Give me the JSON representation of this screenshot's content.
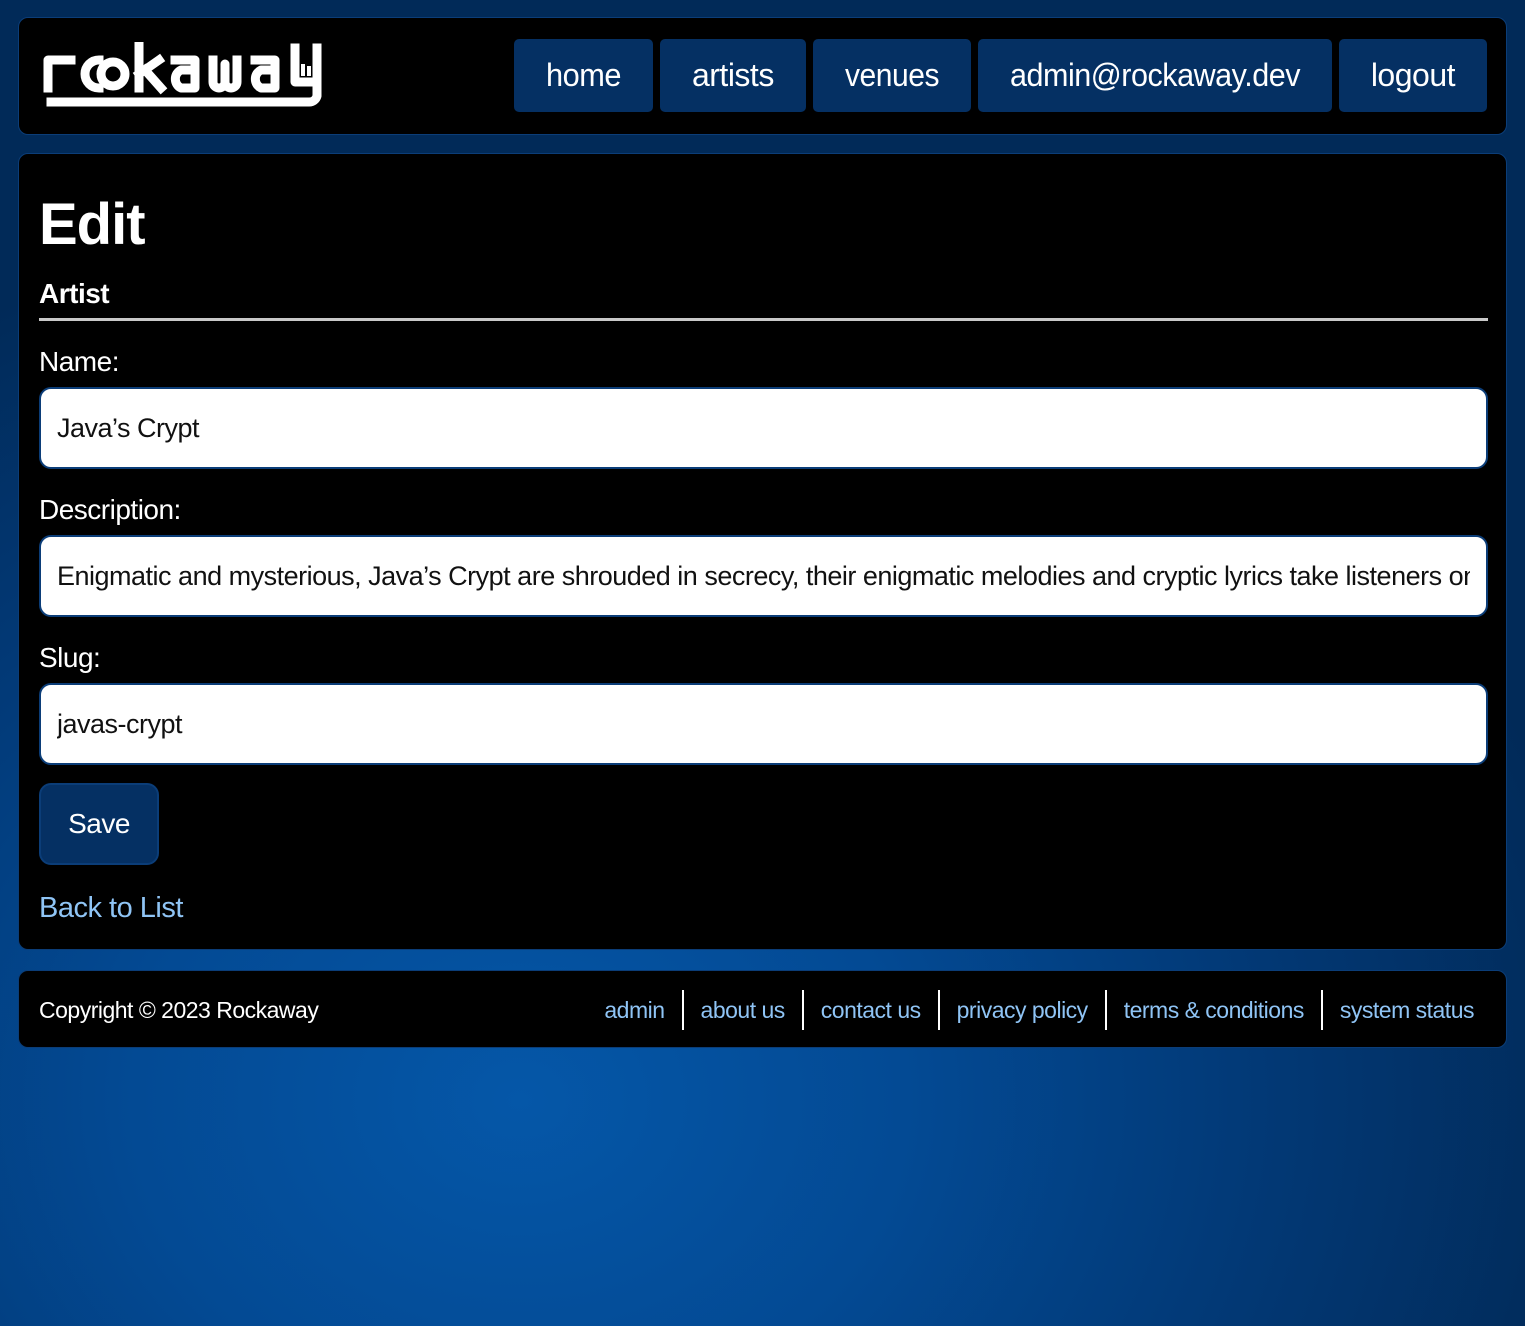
{
  "brand": {
    "logo_text": "rockaway"
  },
  "nav": {
    "items": [
      {
        "label": "home"
      },
      {
        "label": "artists"
      },
      {
        "label": "venues"
      },
      {
        "label": "admin@rockaway.dev"
      },
      {
        "label": "logout"
      }
    ]
  },
  "main": {
    "title": "Edit",
    "section": "Artist",
    "fields": {
      "name": {
        "label": "Name:",
        "value": "Java’s Crypt"
      },
      "description": {
        "label": "Description:",
        "value": "Enigmatic and mysterious, Java’s Crypt are shrouded in secrecy, their enigmatic melodies and cryptic lyrics take listeners on a thril"
      },
      "slug": {
        "label": "Slug:",
        "value": "javas-crypt"
      }
    },
    "save_label": "Save",
    "back_link": "Back to List"
  },
  "footer": {
    "copyright": "Copyright © 2023 Rockaway",
    "links": [
      {
        "label": "admin"
      },
      {
        "label": "about us"
      },
      {
        "label": "contact us"
      },
      {
        "label": "privacy policy"
      },
      {
        "label": "terms & conditions"
      },
      {
        "label": "system status"
      }
    ]
  },
  "colors": {
    "nav_button_bg": "#053063",
    "link": "#8fc4f5",
    "panel_bg": "#000000",
    "page_bg": "#034a94"
  }
}
